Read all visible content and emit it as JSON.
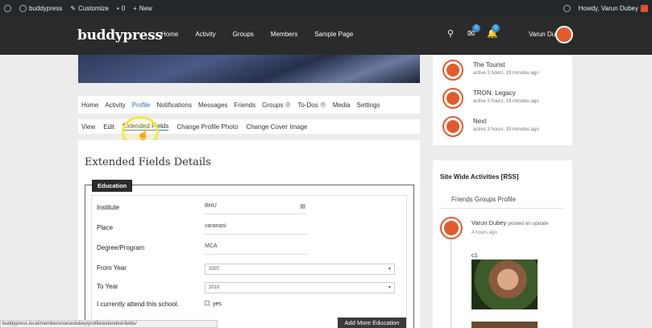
{
  "adminbar": {
    "site": "buddypress",
    "customize": "Customize",
    "comments_count": "0",
    "new": "New",
    "notif_count": "0",
    "howdy": "Howdy, Varun Dubey"
  },
  "header": {
    "logo": "buddypress",
    "nav": [
      "Home",
      "Activity",
      "Groups",
      "Members",
      "Sample Page"
    ],
    "messages_badge": "0",
    "notifications_badge": "0",
    "username": "Varun Dubey"
  },
  "profile_nav": {
    "items": [
      {
        "label": "Home"
      },
      {
        "label": "Activity"
      },
      {
        "label": "Profile"
      },
      {
        "label": "Notifications"
      },
      {
        "label": "Messages"
      },
      {
        "label": "Friends"
      },
      {
        "label": "Groups",
        "count": "2"
      },
      {
        "label": "To-Dos",
        "count": "0"
      },
      {
        "label": "Media"
      },
      {
        "label": "Settings"
      }
    ]
  },
  "sub_nav": {
    "items": [
      "View",
      "Edit",
      "Extended Fields",
      "Change Profile Photo",
      "Change Cover Image"
    ]
  },
  "main": {
    "title": "Extended Fields Details",
    "section": "Education",
    "fields": [
      {
        "label": "Institute",
        "value": "BHU"
      },
      {
        "label": "Place",
        "value": "varanasi"
      },
      {
        "label": "Degree/Program",
        "value": "MCA"
      },
      {
        "label": "From Year",
        "value": "2007"
      },
      {
        "label": "To Year",
        "value": "2010"
      },
      {
        "label": "I currently attend this school.",
        "value": "yes"
      }
    ],
    "add_button": "Add More Education"
  },
  "sidebar_members": [
    {
      "name": "The Tourist",
      "activity": "active 3 hours, 19 minutes ago"
    },
    {
      "name": "TRON: Legacy",
      "activity": "active 3 hours, 19 minutes ago"
    },
    {
      "name": "Next",
      "activity": "active 3 hours, 19 minutes ago"
    }
  ],
  "sidebar_activity": {
    "title": "Site Wide Activities [RSS]",
    "tabs": "Friends Groups Profile",
    "entry": {
      "user": "Varun Dubey",
      "action": "posted an update",
      "time": "4 hours ago",
      "text": "c1"
    }
  },
  "statusbar": {
    "url": "buddypress.local/members/varundubey/profile/extended-fields/"
  }
}
